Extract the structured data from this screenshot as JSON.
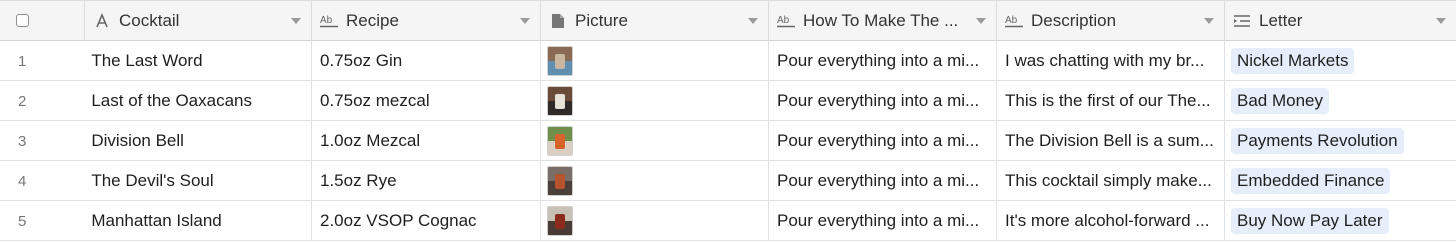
{
  "columns": [
    {
      "key": "cocktail",
      "label": "Cocktail",
      "icon": "text-a-icon"
    },
    {
      "key": "recipe",
      "label": "Recipe",
      "icon": "long-text-icon"
    },
    {
      "key": "picture",
      "label": "Picture",
      "icon": "file-icon"
    },
    {
      "key": "how",
      "label": "How To Make The ...",
      "icon": "long-text-icon"
    },
    {
      "key": "description",
      "label": "Description",
      "icon": "long-text-icon"
    },
    {
      "key": "letter",
      "label": "Letter",
      "icon": "single-select-icon"
    }
  ],
  "rows": [
    {
      "num": "1",
      "cocktail": "The Last Word",
      "recipe": "0.75oz Gin",
      "how": "Pour everything into a mi...",
      "description": "I was chatting with my br...",
      "letter": "Nickel Markets",
      "thumb": [
        "#8a6a55",
        "#5f8fb0",
        "#c9b69e"
      ]
    },
    {
      "num": "2",
      "cocktail": "Last of the Oaxacans",
      "recipe": "0.75oz mezcal",
      "how": "Pour everything into a mi...",
      "description": "This is the first of our The...",
      "letter": "Bad Money",
      "thumb": [
        "#6b4a3a",
        "#2f2a28",
        "#e8e1d6"
      ]
    },
    {
      "num": "3",
      "cocktail": "Division Bell",
      "recipe": "1.0oz Mezcal",
      "how": "Pour everything into a mi...",
      "description": "The Division Bell is a sum...",
      "letter": "Payments Revolution",
      "thumb": [
        "#6f8f4a",
        "#d9cfc2",
        "#d8642a"
      ]
    },
    {
      "num": "4",
      "cocktail": "The Devil's Soul",
      "recipe": "1.5oz Rye",
      "how": "Pour everything into a mi...",
      "description": "This cocktail simply make...",
      "letter": "Embedded Finance",
      "thumb": [
        "#7a6e66",
        "#4b3f3a",
        "#b5542f"
      ]
    },
    {
      "num": "5",
      "cocktail": "Manhattan Island",
      "recipe": "2.0oz VSOP Cognac",
      "how": "Pour everything into a mi...",
      "description": "It's more alcohol-forward ...",
      "letter": "Buy Now Pay Later",
      "thumb": [
        "#c8c0b4",
        "#4a3a34",
        "#8c2a1c"
      ]
    }
  ]
}
